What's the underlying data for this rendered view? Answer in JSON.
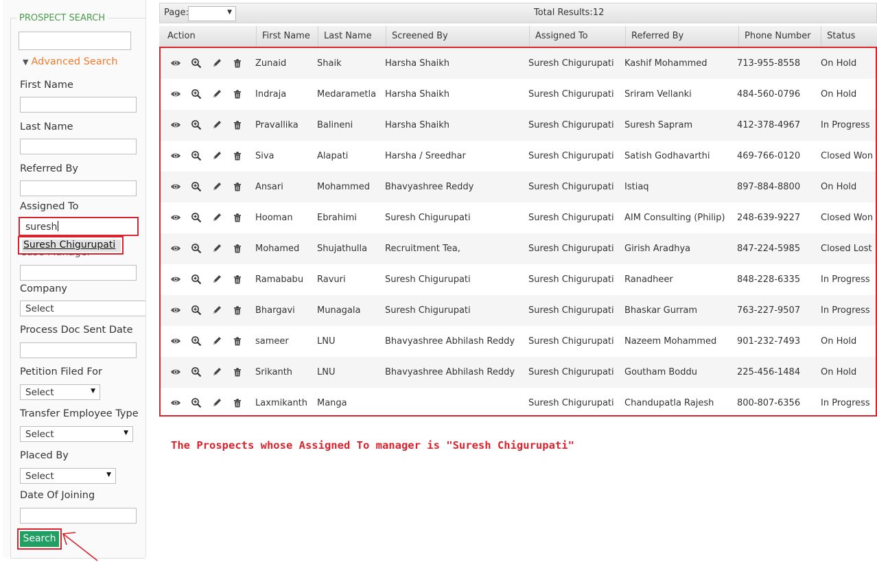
{
  "sidebar": {
    "legend": "PROSPECT SEARCH",
    "advanced_search": "Advanced Search",
    "labels": {
      "first_name": "First Name",
      "last_name": "Last Name",
      "referred_by": "Referred By",
      "assigned_to": "Assigned To",
      "case_manager": "Case Manager",
      "company": "Company",
      "process_doc_sent_date": "Process Doc Sent Date",
      "petition_filed_for": "Petition Filed For",
      "transfer_employee_type": "Transfer Employee Type",
      "placed_by": "Placed By",
      "date_of_joining": "Date Of Joining"
    },
    "assigned_to_value": "suresh",
    "suggestion": "Suresh Chigurupati",
    "select_placeholder": "Select",
    "search_button": "Search"
  },
  "grid": {
    "page_label": "Page:",
    "total_results": "Total Results:12",
    "columns": [
      "Action",
      "First Name",
      "Last Name",
      "Screened By",
      "Assigned To",
      "Referred By",
      "Phone Number",
      "Status"
    ],
    "rows": [
      {
        "first": "Zunaid",
        "last": "Shaik",
        "screened": "Harsha Shaikh",
        "assigned": "Suresh Chigurupati",
        "referred": "Kashif Mohammed",
        "phone": "713-955-8558",
        "status": "On Hold"
      },
      {
        "first": "Indraja",
        "last": "Medarametla",
        "screened": "Harsha Shaikh",
        "assigned": "Suresh Chigurupati",
        "referred": "Sriram Vellanki",
        "phone": "484-560-0796",
        "status": "On Hold"
      },
      {
        "first": "Pravallika",
        "last": "Balineni",
        "screened": "Harsha Shaikh",
        "assigned": "Suresh Chigurupati",
        "referred": "Suresh Sapram",
        "phone": "412-378-4967",
        "status": "In Progress"
      },
      {
        "first": "Siva",
        "last": "Alapati",
        "screened": "Harsha / Sreedhar",
        "assigned": "Suresh Chigurupati",
        "referred": "Satish Godhavarthi",
        "phone": "469-766-0120",
        "status": "Closed Won"
      },
      {
        "first": "Ansari",
        "last": "Mohammed",
        "screened": "Bhavyashree Reddy",
        "assigned": "Suresh Chigurupati",
        "referred": "Istiaq",
        "phone": "897-884-8800",
        "status": "On Hold"
      },
      {
        "first": "Hooman",
        "last": "Ebrahimi",
        "screened": "Suresh Chigurupati",
        "assigned": "Suresh Chigurupati",
        "referred": "AIM Consulting (Philip)",
        "phone": "248-639-9227",
        "status": "Closed Won"
      },
      {
        "first": "Mohamed",
        "last": "Shujathulla",
        "screened": "Recruitment Tea,",
        "assigned": "Suresh Chigurupati",
        "referred": "Girish Aradhya",
        "phone": "847-224-5985",
        "status": "Closed Lost"
      },
      {
        "first": "Ramababu",
        "last": "Ravuri",
        "screened": "Suresh Chigurupati",
        "assigned": "Suresh Chigurupati",
        "referred": "Ranadheer",
        "phone": "848-228-6335",
        "status": "In Progress"
      },
      {
        "first": "Bhargavi",
        "last": "Munagala",
        "screened": "Suresh Chigurupati",
        "assigned": "Suresh Chigurupati",
        "referred": "Bhaskar Gurram",
        "phone": "763-227-9507",
        "status": "In Progress"
      },
      {
        "first": "sameer",
        "last": "LNU",
        "screened": "Bhavyashree Abhilash Reddy",
        "assigned": "Suresh Chigurupati",
        "referred": "Nazeem Mohammed",
        "phone": "901-232-7493",
        "status": "On Hold"
      },
      {
        "first": "Srikanth",
        "last": "LNU",
        "screened": "Bhavyashree Abhilash Reddy",
        "assigned": "Suresh Chigurupati",
        "referred": "Goutham Boddu",
        "phone": "225-456-1484",
        "status": "On Hold"
      },
      {
        "first": "Laxmikanth",
        "last": "Manga",
        "screened": "",
        "assigned": "Suresh Chigurupati",
        "referred": "Chandupatla Rajesh",
        "phone": "800-807-6356",
        "status": "In Progress"
      }
    ],
    "action_icons": [
      "eye-icon",
      "zoom-icon",
      "edit-icon",
      "delete-icon"
    ]
  },
  "annotation": "The Prospects whose Assigned To manager is \"Suresh Chigurupati\"",
  "colors": {
    "accent_red": "#d9232d",
    "legend_green": "#4a9a4a",
    "advanced_orange": "#f07a2c",
    "search_green": "#1f9f62"
  }
}
